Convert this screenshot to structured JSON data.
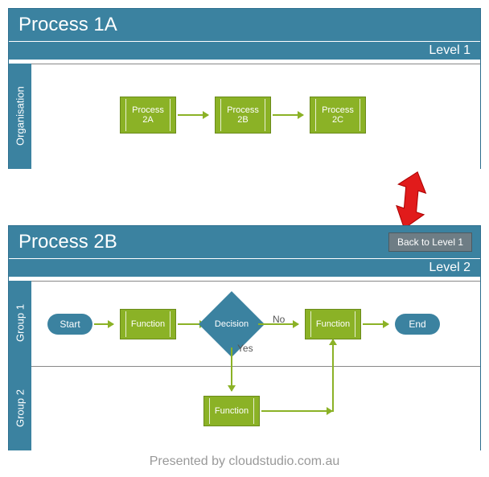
{
  "panel1": {
    "title": "Process 1A",
    "level": "Level 1",
    "lane": "Organisation",
    "boxes": [
      "Process\n2A",
      "Process\n2B",
      "Process\n2C"
    ]
  },
  "panel2": {
    "title": "Process 2B",
    "level": "Level 2",
    "back": "Back to Level 1",
    "lanes": [
      "Group 1",
      "Group 2"
    ],
    "start": "Start",
    "end": "End",
    "fn": "Function",
    "decision": "Decision",
    "yes": "Yes",
    "no": "No"
  },
  "footer": "Presented by cloudstudio.com.au",
  "chart_data": [
    {
      "type": "flowchart",
      "title": "Process 1A",
      "level": "Level 1",
      "lanes": [
        "Organisation"
      ],
      "nodes": [
        {
          "id": "p2a",
          "lane": "Organisation",
          "type": "process",
          "label": "Process 2A"
        },
        {
          "id": "p2b",
          "lane": "Organisation",
          "type": "process",
          "label": "Process 2B"
        },
        {
          "id": "p2c",
          "lane": "Organisation",
          "type": "process",
          "label": "Process 2C"
        }
      ],
      "edges": [
        {
          "from": "p2a",
          "to": "p2b"
        },
        {
          "from": "p2b",
          "to": "p2c"
        }
      ]
    },
    {
      "type": "flowchart",
      "title": "Process 2B",
      "level": "Level 2",
      "lanes": [
        "Group 1",
        "Group 2"
      ],
      "nodes": [
        {
          "id": "start",
          "lane": "Group 1",
          "type": "terminator",
          "label": "Start"
        },
        {
          "id": "f1",
          "lane": "Group 1",
          "type": "process",
          "label": "Function"
        },
        {
          "id": "d1",
          "lane": "Group 1",
          "type": "decision",
          "label": "Decision"
        },
        {
          "id": "f2",
          "lane": "Group 1",
          "type": "process",
          "label": "Function"
        },
        {
          "id": "end",
          "lane": "Group 1",
          "type": "terminator",
          "label": "End"
        },
        {
          "id": "f3",
          "lane": "Group 2",
          "type": "process",
          "label": "Function"
        }
      ],
      "edges": [
        {
          "from": "start",
          "to": "f1"
        },
        {
          "from": "f1",
          "to": "d1"
        },
        {
          "from": "d1",
          "to": "f2",
          "label": "No"
        },
        {
          "from": "d1",
          "to": "f3",
          "label": "Yes"
        },
        {
          "from": "f3",
          "to": "f2"
        },
        {
          "from": "f2",
          "to": "end"
        }
      ]
    }
  ]
}
